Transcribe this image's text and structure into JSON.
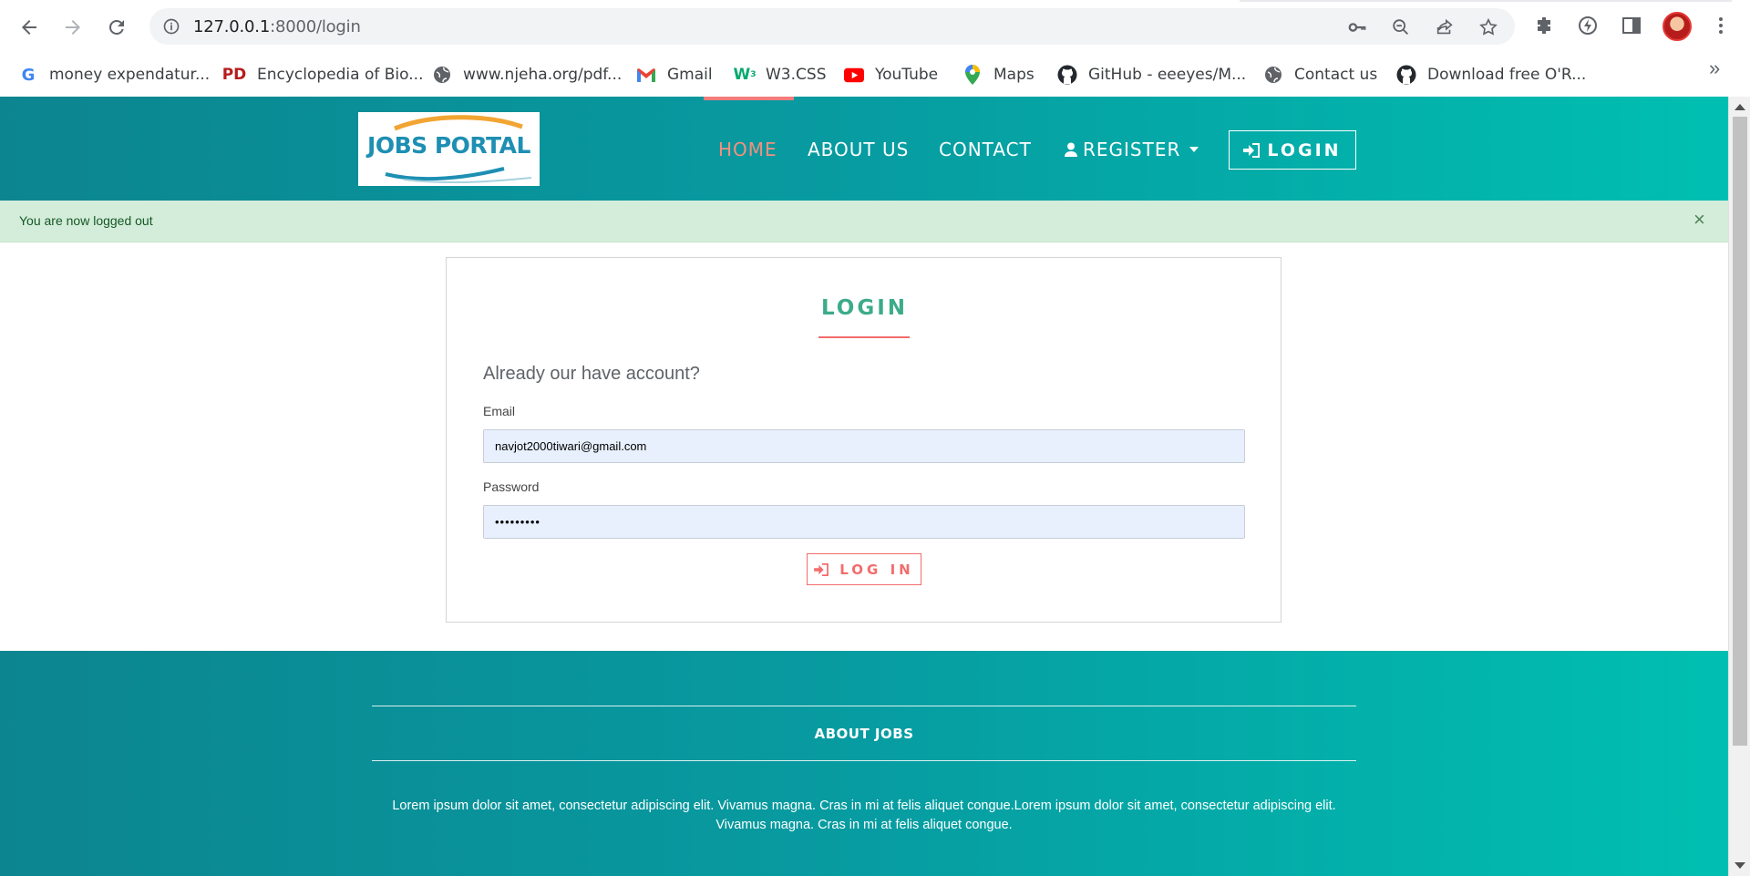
{
  "browser": {
    "url_host": "127.0.0.1",
    "url_path": ":8000/login",
    "bookmarks": [
      {
        "label": "money expendatur...",
        "icon": "google-icon"
      },
      {
        "label": "Encyclopedia of Bio...",
        "icon": "pd-icon"
      },
      {
        "label": "www.njeha.org/pdf...",
        "icon": "globe-icon"
      },
      {
        "label": "Gmail",
        "icon": "gmail-icon"
      },
      {
        "label": "W3.CSS",
        "icon": "w3-icon"
      },
      {
        "label": "YouTube",
        "icon": "youtube-icon"
      },
      {
        "label": "Maps",
        "icon": "maps-icon"
      },
      {
        "label": "GitHub - eeeyes/M...",
        "icon": "github-icon"
      },
      {
        "label": "Contact us",
        "icon": "globe-icon"
      },
      {
        "label": "Download free O'R...",
        "icon": "github-icon"
      }
    ],
    "more_bookmarks": "»"
  },
  "site": {
    "logo_text": "JOBS PORTAL",
    "nav": {
      "home": "HOME",
      "about": "ABOUT US",
      "contact": "CONTACT",
      "register": "REGISTER",
      "login": "LOGIN"
    },
    "alert": {
      "message": "You are now logged out",
      "close": "×"
    },
    "login_card": {
      "title": "LOGIN",
      "subtitle": "Already our have account?",
      "email_label": "Email",
      "email_value": "navjot2000tiwari@gmail.com",
      "password_label": "Password",
      "password_value": "•••••••••",
      "button_label": "LOG IN"
    },
    "footer": {
      "title": "ABOUT JOBS",
      "text": "Lorem ipsum dolor sit amet, consectetur adipiscing elit. Vivamus magna. Cras in mi at felis aliquet congue.Lorem ipsum dolor sit amet, consectetur adipiscing elit. Vivamus magna. Cras in mi at felis aliquet congue."
    }
  },
  "colors": {
    "header_gradient_start": "#0c8590",
    "header_gradient_end": "#00bfb1",
    "nav_active": "#f4907e",
    "card_title": "#3cab8a",
    "accent_red": "#f36c6c",
    "alert_bg": "#d4edda",
    "input_bg": "#e8f0fe"
  }
}
